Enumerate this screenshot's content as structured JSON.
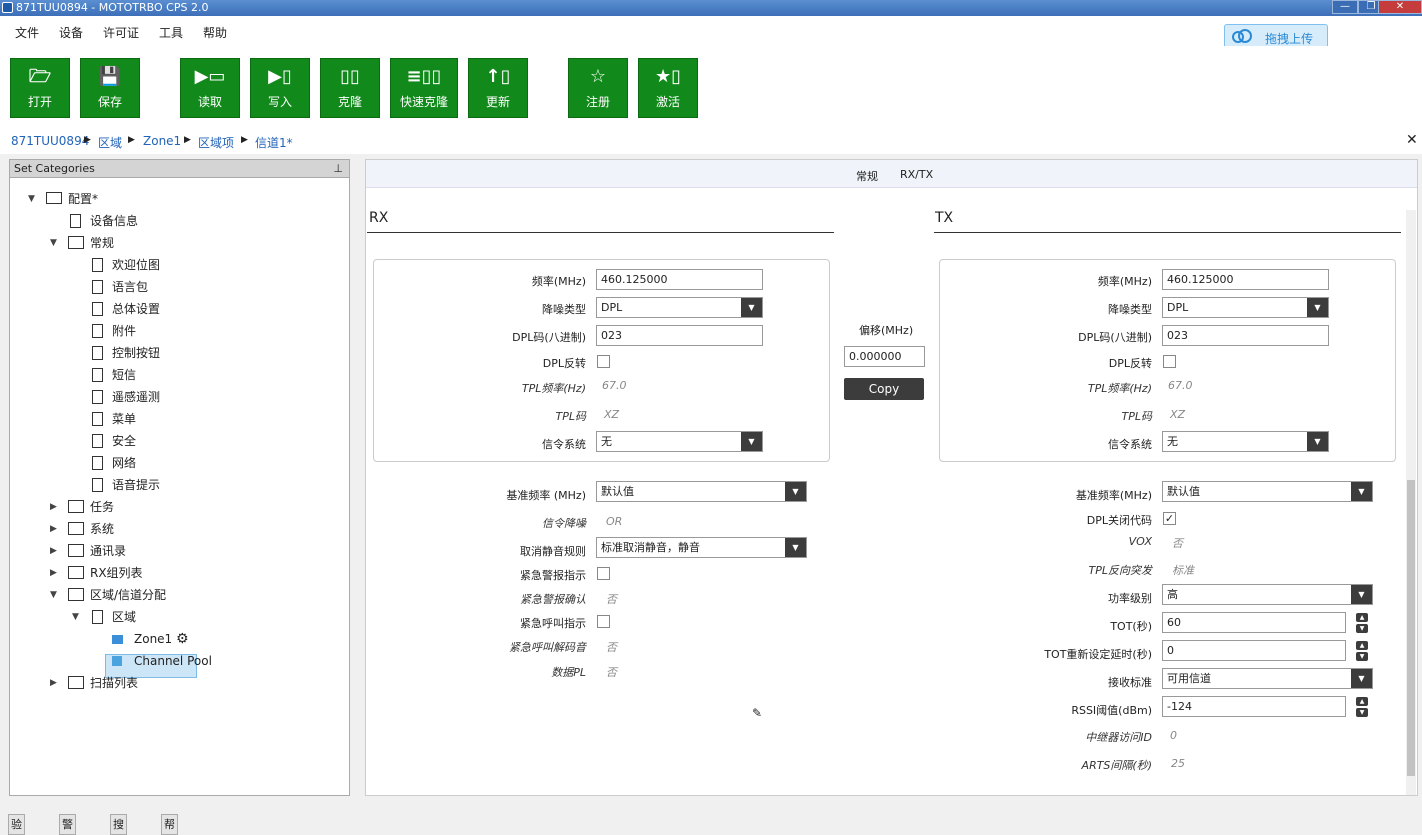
{
  "window": {
    "title": "871TUU0894 - MOTOTRBO CPS 2.0"
  },
  "menu": [
    "文件",
    "设备",
    "许可证",
    "工具",
    "帮助"
  ],
  "upload": {
    "label": "拖拽上传"
  },
  "toolbar": [
    {
      "label": "打开",
      "icon": "open-folder-icon",
      "glyph": "🗁"
    },
    {
      "label": "保存",
      "icon": "save-icon",
      "glyph": "💾"
    },
    {
      "label": "读取",
      "icon": "read-icon",
      "glyph": "▶▭"
    },
    {
      "label": "写入",
      "icon": "write-icon",
      "glyph": "▶▯"
    },
    {
      "label": "克隆",
      "icon": "clone-icon",
      "glyph": "▯▯"
    },
    {
      "label": "快速克隆",
      "icon": "fast-clone-icon",
      "glyph": "≡▯▯"
    },
    {
      "label": "更新",
      "icon": "update-icon",
      "glyph": "↑▯"
    },
    {
      "label": "注册",
      "icon": "register-icon",
      "glyph": "☆"
    },
    {
      "label": "激活",
      "icon": "activate-icon",
      "glyph": "★▯"
    }
  ],
  "breadcrumb": [
    "871TUU0894",
    "区域",
    "Zone1",
    "区域项",
    "信道1*"
  ],
  "left_panel": {
    "title": "Set Categories",
    "tree": [
      {
        "label": "配置*",
        "level": 0,
        "icon": "config",
        "expanded": true
      },
      {
        "label": "设备信息",
        "level": 1,
        "icon": "device"
      },
      {
        "label": "常规",
        "level": 1,
        "icon": "folder",
        "expanded": true
      },
      {
        "label": "欢迎位图",
        "level": 2,
        "icon": "doc"
      },
      {
        "label": "语言包",
        "level": 2,
        "icon": "doc"
      },
      {
        "label": "总体设置",
        "level": 2,
        "icon": "doc"
      },
      {
        "label": "附件",
        "level": 2,
        "icon": "doc"
      },
      {
        "label": "控制按钮",
        "level": 2,
        "icon": "doc"
      },
      {
        "label": "短信",
        "level": 2,
        "icon": "doc"
      },
      {
        "label": "遥感遥测",
        "level": 2,
        "icon": "doc"
      },
      {
        "label": "菜单",
        "level": 2,
        "icon": "doc"
      },
      {
        "label": "安全",
        "level": 2,
        "icon": "doc"
      },
      {
        "label": "网络",
        "level": 2,
        "icon": "doc"
      },
      {
        "label": "语音提示",
        "level": 2,
        "icon": "doc"
      },
      {
        "label": "任务",
        "level": 1,
        "icon": "folder",
        "expanded": false
      },
      {
        "label": "系统",
        "level": 1,
        "icon": "folder",
        "expanded": false
      },
      {
        "label": "通讯录",
        "level": 1,
        "icon": "folder",
        "expanded": false
      },
      {
        "label": "RX组列表",
        "level": 1,
        "icon": "folder",
        "expanded": false
      },
      {
        "label": "区域/信道分配",
        "level": 1,
        "icon": "folder",
        "expanded": true
      },
      {
        "label": "区域",
        "level": 2,
        "icon": "docs",
        "expanded": true
      },
      {
        "label": "Zone1",
        "level": 3,
        "icon": "zone",
        "selected": true
      },
      {
        "label": "Channel Pool",
        "level": 3,
        "icon": "pool"
      },
      {
        "label": "扫描列表",
        "level": 1,
        "icon": "folder",
        "expanded": false
      }
    ]
  },
  "tabs": [
    "常规",
    "RX/TX"
  ],
  "rx": {
    "title": "RX",
    "freq_label": "频率(MHz)",
    "freq": "460.125000",
    "squelch_label": "降噪类型",
    "squelch": "DPL",
    "dpl_label": "DPL码(八进制)",
    "dpl": "023",
    "dpl_inv_label": "DPL反转",
    "tpl_freq_label": "TPL频率(Hz)",
    "tpl_freq": "67.0",
    "tpl_code_label": "TPL码",
    "tpl_code": "XZ",
    "signal_label": "信令系统",
    "signal": "无",
    "ref_freq_label": "基准频率 (MHz)",
    "ref_freq": "默认值",
    "sig_squelch_label": "信令降噪",
    "sig_squelch": "OR",
    "unmute_label": "取消静音规则",
    "unmute": "标准取消静音，静音",
    "emerg_ind_label": "紧急警报指示",
    "emerg_ack_label": "紧急警报确认",
    "emerg_ack": "否",
    "emerg_call_label": "紧急呼叫指示",
    "emerg_decode_label": "紧急呼叫解码音",
    "emerg_decode": "否",
    "data_pl_label": "数据PL",
    "data_pl": "否"
  },
  "offset": {
    "label": "偏移(MHz)",
    "value": "0.000000",
    "copy": "Copy"
  },
  "tx": {
    "title": "TX",
    "freq_label": "频率(MHz)",
    "freq": "460.125000",
    "squelch_label": "降噪类型",
    "squelch": "DPL",
    "dpl_label": "DPL码(八进制)",
    "dpl": "023",
    "dpl_inv_label": "DPL反转",
    "tpl_freq_label": "TPL频率(Hz)",
    "tpl_freq": "67.0",
    "tpl_code_label": "TPL码",
    "tpl_code": "XZ",
    "signal_label": "信令系统",
    "signal": "无",
    "ref_freq_label": "基准频率(MHz)",
    "ref_freq": "默认值",
    "dpl_close_label": "DPL关闭代码",
    "dpl_close": "✓",
    "vox_label": "VOX",
    "vox": "否",
    "tpl_rev_label": "TPL反向突发",
    "tpl_rev": "标准",
    "power_label": "功率级别",
    "power": "高",
    "tot_label": "TOT(秒)",
    "tot": "60",
    "tot_rekey_label": "TOT重新设定延时(秒)",
    "tot_rekey": "0",
    "rx_std_label": "接收标准",
    "rx_std": "可用信道",
    "rssi_label": "RSSI阈值(dBm)",
    "rssi": "-124",
    "repeater_label": "中继器访问ID",
    "repeater": "0",
    "arts_label": "ARTS间隔(秒)",
    "arts": "25"
  },
  "bottom_tabs": [
    "验证结果",
    "警告消息",
    "搜索结果",
    "帮助"
  ],
  "colors": {
    "toolbar_green": "#118a1b",
    "link_blue": "#2264b8",
    "selection": "#cde6f7"
  }
}
